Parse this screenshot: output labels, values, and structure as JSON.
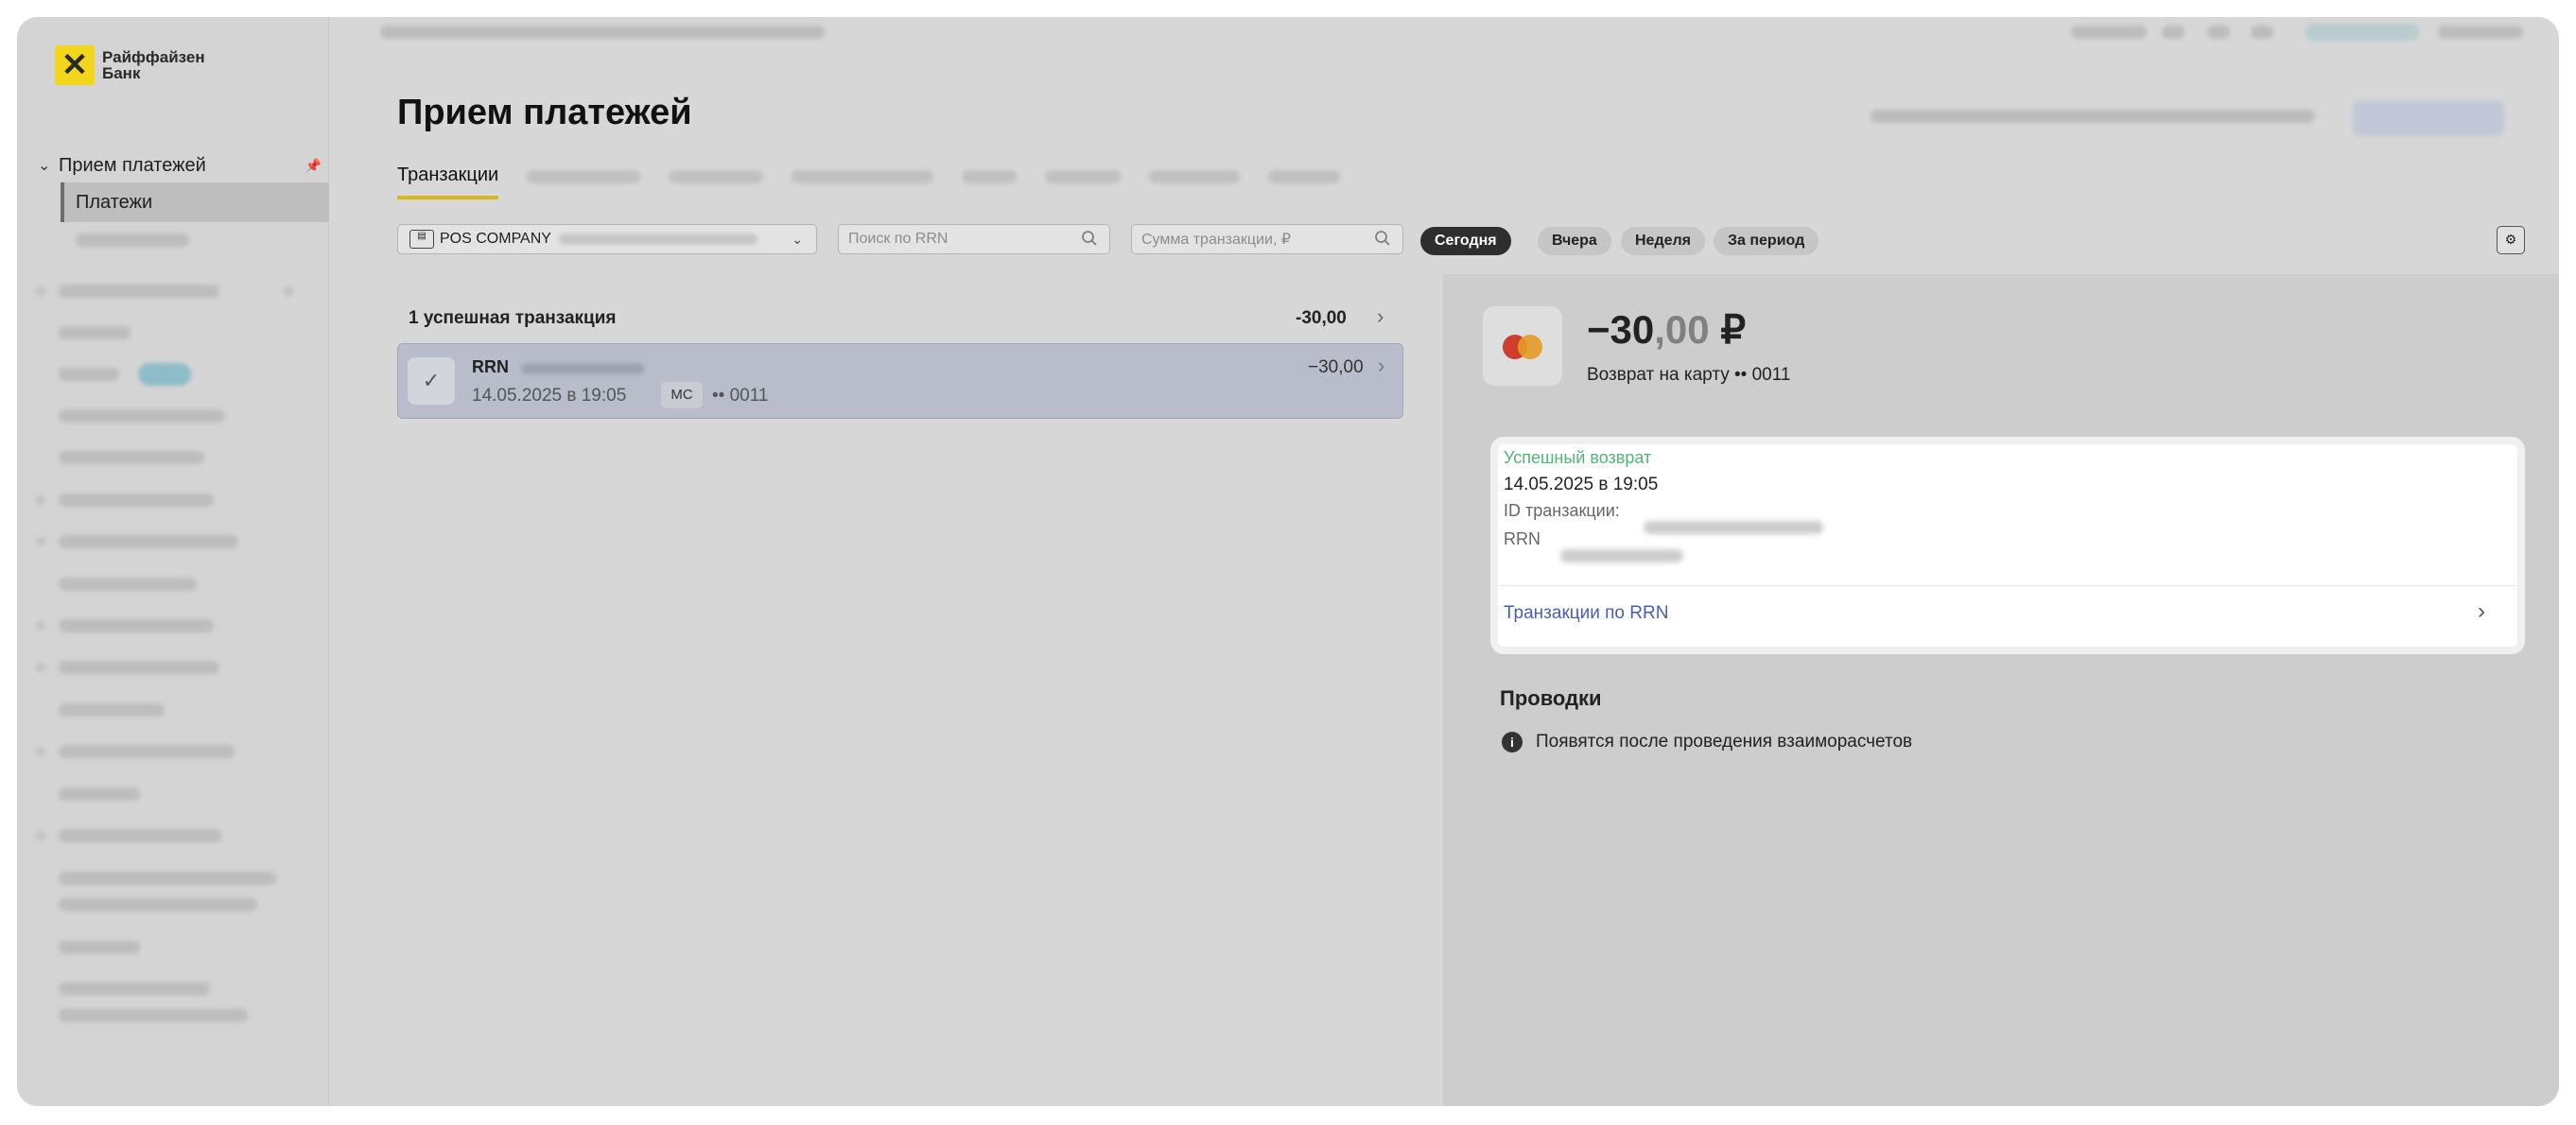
{
  "sidebar": {
    "logo_mark": "✕",
    "logo_line1": "Райффайзен",
    "logo_line2": "Банк",
    "section_label": "Прием платежей",
    "section_chevron": "⌄",
    "pin_icon": "📌",
    "active_item": "Платежи"
  },
  "main": {
    "title": "Прием платежей",
    "active_tab": "Транзакции"
  },
  "filters": {
    "terminal_value": "POS COMPANY",
    "terminal_icon": "▤",
    "rrn_placeholder": "Поиск по RRN",
    "amount_placeholder": "Сумма транзакции, ₽",
    "periods": [
      "Сегодня",
      "Вчера",
      "Неделя",
      "За период"
    ],
    "selected_period": "Сегодня",
    "settings_icon": "⚙"
  },
  "list": {
    "summary": "1 успешная транзакция",
    "summary_amount": "-30,00",
    "transactions": [
      {
        "rrn_label": "RRN",
        "datetime": "14.05.2025 в 19:05",
        "payment_system": "MC",
        "card": "•• 0011",
        "amount": "−30,00"
      }
    ]
  },
  "details": {
    "amount_int": "−30",
    "amount_frac": ",00",
    "currency": "₽",
    "subtitle": "Возврат на карту •• 0011",
    "status": "Успешный возврат",
    "datetime": "14.05.2025 в 19:05",
    "tx_id_label": "ID транзакции:",
    "rrn_label": "RRN",
    "link_text": "Транзакции по RRN",
    "postings_title": "Проводки",
    "postings_info": "Появятся после проведения взаиморасчетов",
    "info_icon": "i"
  },
  "colors": {
    "accent": "#d9b81e",
    "success": "#51b577",
    "link": "#4a5fb0",
    "selected_row": "#b9bdcb"
  }
}
